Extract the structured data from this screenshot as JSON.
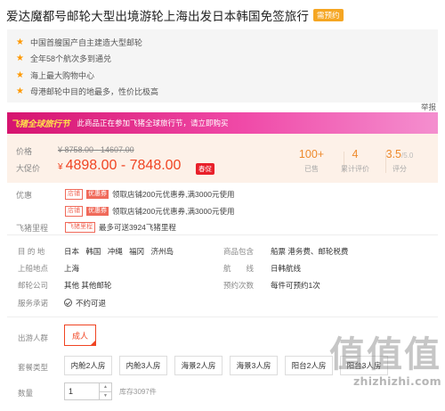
{
  "product": {
    "title": "爱达魔都号邮轮大型出境游轮上海出发日本韩国免签旅行",
    "badge": "需预约"
  },
  "highlights": [
    "中国首艘国产自主建造大型邮轮",
    "全年58个航次多到通兑",
    "海上最大购物中心",
    "母港邮轮中目的地最多，性价比极高"
  ],
  "share_label": "举报",
  "promo": {
    "tag": "飞猪全球旅行节",
    "text": "此商品正在参加飞猪全球旅行节，请立即购买"
  },
  "price": {
    "orig_label": "价格",
    "orig_value": "¥ 8758.00 - 14607.00",
    "cur_label": "大促价",
    "currency": "¥",
    "cur_value": "4898.00 - 7848.00",
    "tag": "春促"
  },
  "stats": [
    {
      "value": "100+",
      "suffix": "",
      "label": "已售"
    },
    {
      "value": "4",
      "suffix": "",
      "label": "累计评价"
    },
    {
      "value": "3.5",
      "suffix": "/5.0",
      "label": "评分"
    }
  ],
  "coupons": {
    "label": "优惠",
    "items": [
      {
        "tag1": "店铺",
        "tag2": "优惠券",
        "text": "领取店铺200元优惠券,满3000元使用"
      },
      {
        "tag1": "店铺",
        "tag2": "优惠券",
        "text": "领取店铺200元优惠券,满3000元使用"
      }
    ]
  },
  "points": {
    "label": "飞猪里程",
    "tag": "飞猪里程",
    "text": "最多可送3924飞猪里程"
  },
  "info": {
    "destination_label": "目 的 地",
    "destination": "日本 韩国 冲绳 福冈 济州岛",
    "includes_label": "商品包含",
    "includes": "船票 港务费、邮轮税费",
    "departure_label": "上船地点",
    "departure": "上海",
    "route_label": "航　　线",
    "route": "日韩航线",
    "company_label": "邮轮公司",
    "company": "其他 其他邮轮",
    "booking_label": "预约次数",
    "booking": "每件可预约1次",
    "service_label": "服务承诺",
    "service": "不约可退"
  },
  "options": {
    "traveler_label": "出游人群",
    "traveler": "成人",
    "package_label": "套餐类型",
    "packages": [
      "内舱2人房",
      "内舱3人房",
      "海景2人房",
      "海景3人房",
      "阳台2人房",
      "阳台3人房"
    ]
  },
  "quantity": {
    "label": "数量",
    "value": "1",
    "stock": "库存3097件"
  },
  "watermark": {
    "big": "值值值",
    "small": "zhizhizhi.com"
  }
}
